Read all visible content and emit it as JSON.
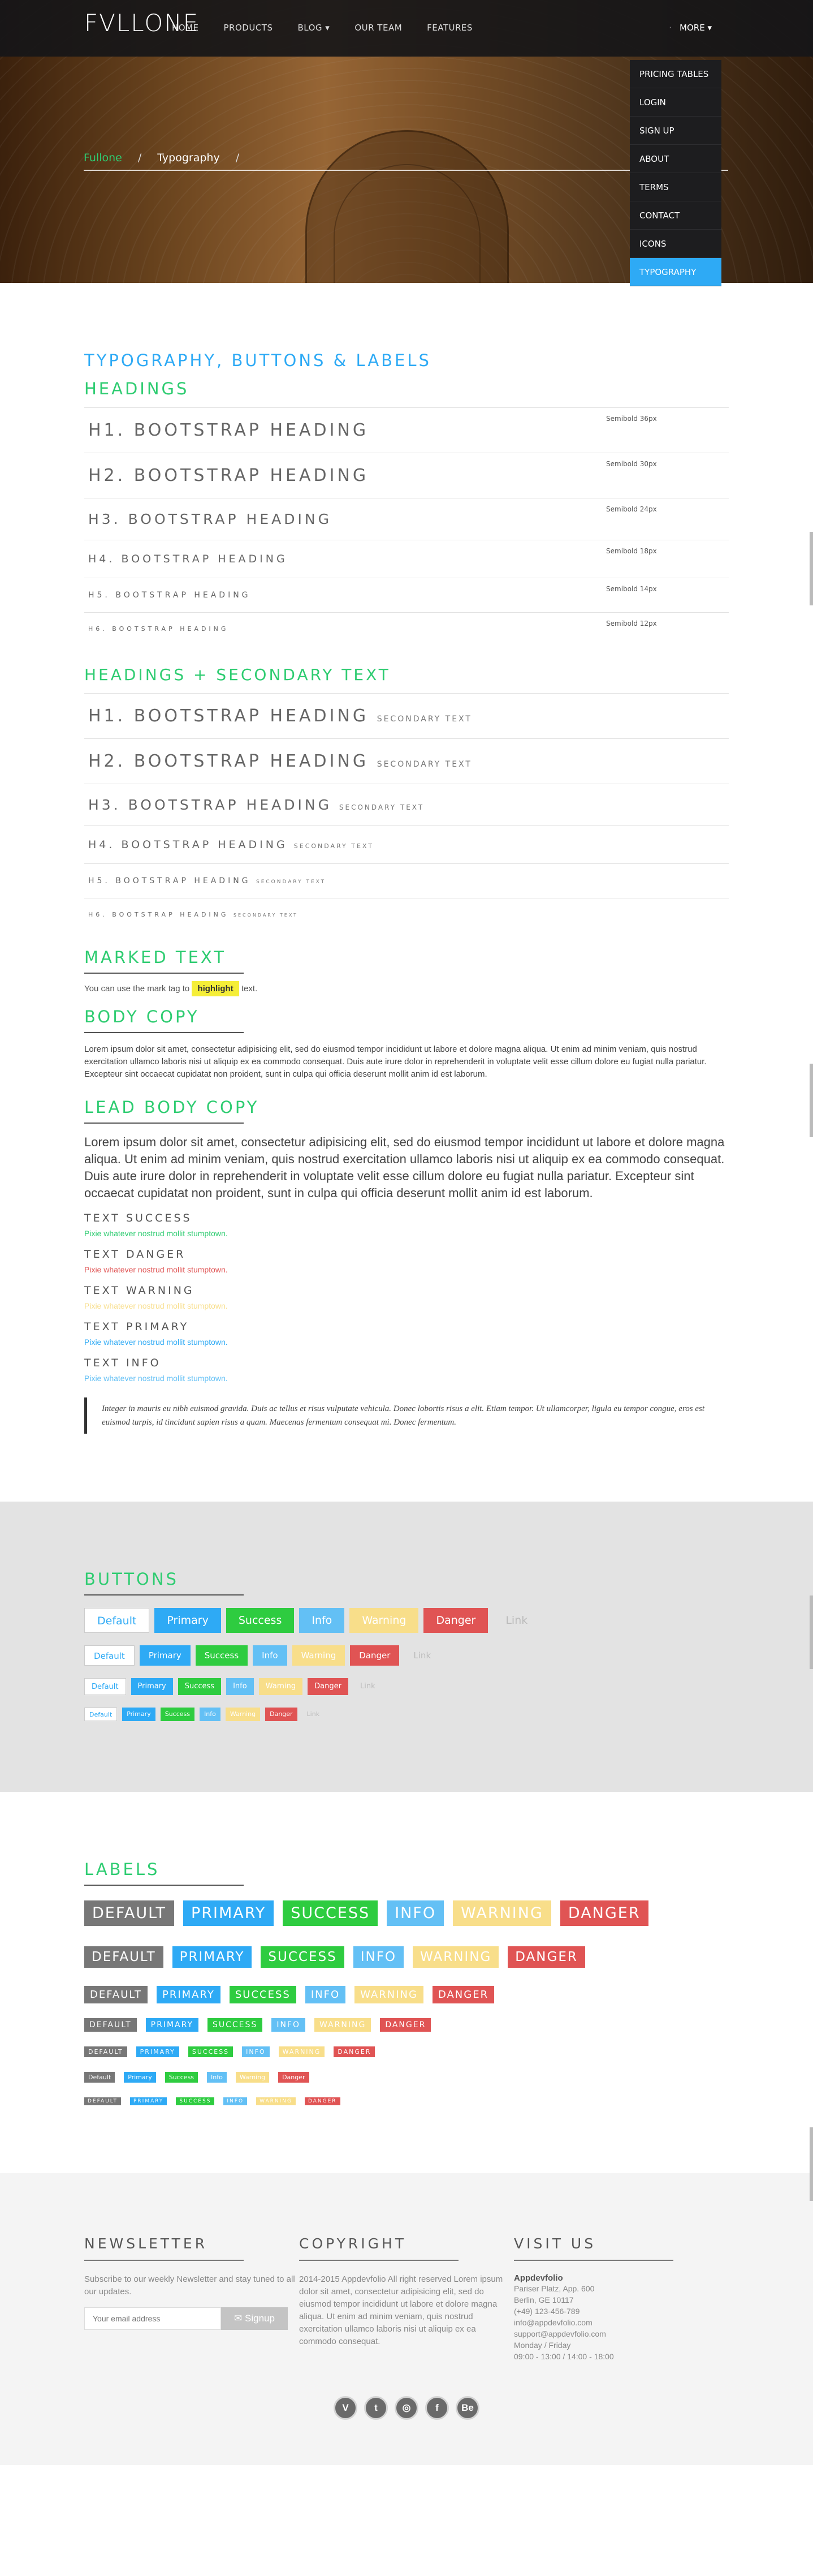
{
  "nav": {
    "logo": "FVLLONE",
    "items": [
      "HOME",
      "PRODUCTS",
      "BLOG ▾",
      "OUR TEAM",
      "FEATURES"
    ],
    "more": "MORE ▾",
    "more_dot": "·",
    "dropdown": [
      "PRICING TABLES",
      "LOGIN",
      "SIGN UP",
      "ABOUT",
      "TERMS",
      "CONTACT",
      "ICONS",
      "TYPOGRAPHY"
    ]
  },
  "breadcrumb": {
    "home": "Fullone",
    "sep": "/",
    "current": "Typography"
  },
  "typography": {
    "title": "TYPOGRAPHY, BUTTONS & LABELS",
    "headings_title": "HEADINGS",
    "headings": [
      {
        "text": "H1. BOOTSTRAP HEADING",
        "meta": "Semibold 36px"
      },
      {
        "text": "H2. BOOTSTRAP HEADING",
        "meta": "Semibold 30px"
      },
      {
        "text": "H3. BOOTSTRAP HEADING",
        "meta": "Semibold 24px"
      },
      {
        "text": "H4. BOOTSTRAP HEADING",
        "meta": "Semibold 18px"
      },
      {
        "text": "H5. BOOTSTRAP HEADING",
        "meta": "Semibold 14px"
      },
      {
        "text": "H6. BOOTSTRAP HEADING",
        "meta": "Semibold 12px"
      }
    ],
    "secondary_title": "HEADINGS + SECONDARY TEXT",
    "secondary_label": "SECONDARY TEXT",
    "marked_title": "MARKED TEXT",
    "marked_before": "You can use the mark tag to",
    "marked_word": "highlight",
    "marked_after": "text.",
    "body_title": "BODY COPY",
    "body_text": "Lorem ipsum dolor sit amet, consectetur adipisicing elit, sed do eiusmod tempor incididunt ut labore et dolore magna aliqua. Ut enim ad minim veniam, quis nostrud exercitation ullamco laboris nisi ut aliquip ex ea commodo consequat. Duis aute irure dolor in reprehenderit in voluptate velit esse cillum dolore eu fugiat nulla pariatur. Excepteur sint occaecat cupidatat non proident, sunt in culpa qui officia deserunt mollit anim id est laborum.",
    "lead_title": "LEAD BODY COPY",
    "lead_text": "Lorem ipsum dolor sit amet, consectetur adipisicing elit, sed do eiusmod tempor incididunt ut labore et dolore magna aliqua. Ut enim ad minim veniam, quis nostrud exercitation ullamco laboris nisi ut aliquip ex ea commodo consequat. Duis aute irure dolor in reprehenderit in voluptate velit esse cillum dolore eu fugiat nulla pariatur. Excepteur sint occaecat cupidatat non proident, sunt in culpa qui officia deserunt mollit anim id est laborum.",
    "text_states": [
      {
        "label": "TEXT SUCCESS",
        "sample": "Pixie whatever nostrud mollit stumptown.",
        "color": "#2ecc71"
      },
      {
        "label": "TEXT DANGER",
        "sample": "Pixie whatever nostrud mollit stumptown.",
        "color": "#e05454"
      },
      {
        "label": "TEXT WARNING",
        "sample": "Pixie whatever nostrud mollit stumptown.",
        "color": "#f8de8a"
      },
      {
        "label": "TEXT PRIMARY",
        "sample": "Pixie whatever nostrud mollit stumptown.",
        "color": "#2eaaf5"
      },
      {
        "label": "TEXT INFO",
        "sample": "Pixie whatever nostrud mollit stumptown.",
        "color": "#63c0f5"
      }
    ],
    "quote": "Integer in mauris eu nibh euismod gravida. Duis ac tellus et risus vulputate vehicula. Donec lobortis risus a elit. Etiam tempor. Ut ullamcorper, ligula eu tempor congue, eros est euismod turpis, id tincidunt sapien risus a quam. Maecenas fermentum consequat mi. Donec fermentum."
  },
  "buttons": {
    "title": "BUTTONS",
    "labels": [
      "Default",
      "Primary",
      "Success",
      "Info",
      "Warning",
      "Danger",
      "Link"
    ]
  },
  "labels": {
    "title": "LABELS",
    "upper": [
      "DEFAULT",
      "PRIMARY",
      "SUCCESS",
      "INFO",
      "WARNING",
      "DANGER"
    ],
    "mixed": [
      "Default",
      "Primary",
      "Success",
      "Info",
      "Warning",
      "Danger"
    ]
  },
  "footer": {
    "newsletter_title": "NEWSLETTER",
    "newsletter_text": "Subscribe to our weekly Newsletter and stay tuned to all our updates.",
    "email_placeholder": "Your email address",
    "signup": "✉ Signup",
    "copyright_title": "COPYRIGHT",
    "copyright_text": "2014-2015 Appdevfolio All right reserved Lorem ipsum dolor sit amet, consectetur adipisicing elit, sed do eiusmod tempor incididunt ut labore et dolore magna aliqua. Ut enim ad minim veniam, quis nostrud exercitation ullamco laboris nisi ut aliquip ex ea commodo consequat.",
    "visit_title": "VISIT US",
    "visit_name": "Appdevfolio",
    "visit_lines": [
      "Pariser Platz, App. 600",
      "Berlin, GE 10117",
      "(+49) 123-456-789",
      "info@appdevfolio.com",
      "support@appdevfolio.com",
      "Monday / Friday",
      "09:00 - 13:00 / 14:00 - 18:00"
    ],
    "socials": [
      "V",
      "t",
      "◎",
      "f",
      "Be"
    ]
  }
}
